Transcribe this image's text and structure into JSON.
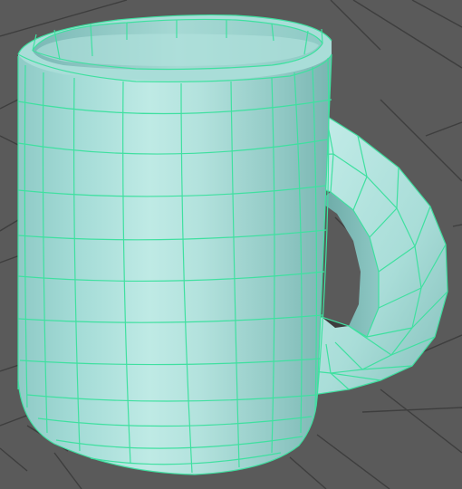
{
  "viewport": {
    "background_color": "#5a5a5a",
    "ground_grid": {
      "visible": true,
      "line_color": "#3e3e3e"
    }
  },
  "model": {
    "object": "mug",
    "display_mode": "smooth-shaded-with-wireframe",
    "wireframe_color": "#3fe0a0",
    "surface_color": "#9fd9d5",
    "highlight_color": "#c4ece8",
    "shadow_color": "#6fb3b0",
    "selected": true,
    "parts": [
      "mug-body",
      "mug-rim",
      "mug-inner-wall",
      "mug-handle"
    ]
  }
}
